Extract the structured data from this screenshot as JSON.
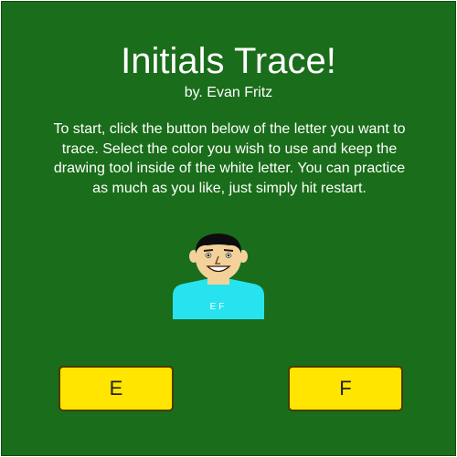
{
  "header": {
    "title": "Initials Trace!",
    "author": "by. Evan Fritz"
  },
  "instructions": "To start, click the button below of the letter you want to trace. Select the color you wish to use and keep the drawing tool inside of the white letter. You can practice as much as you like, just simply hit restart.",
  "avatar": {
    "shirt_text": "EF",
    "shirt_color": "#27e3ef",
    "skin_color": "#f3d29a",
    "hair_color": "#0d0d0d"
  },
  "buttons": {
    "letter_e": "E",
    "letter_f": "F"
  },
  "colors": {
    "background": "#1a6d1a",
    "button": "#ffe500",
    "text": "#ffffff"
  }
}
